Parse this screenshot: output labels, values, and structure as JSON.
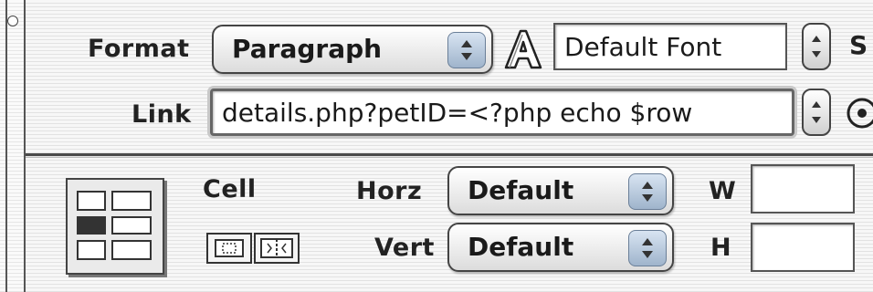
{
  "format": {
    "label": "Format",
    "value": "Paragraph"
  },
  "font": {
    "value": "Default Font",
    "cut_label": "S"
  },
  "link": {
    "label": "Link",
    "value": "details.php?petID=<?php echo $row"
  },
  "cell": {
    "label": "Cell",
    "horz_label": "Horz",
    "horz_value": "Default",
    "vert_label": "Vert",
    "vert_value": "Default",
    "w_label": "W",
    "w_value": "",
    "h_label": "H",
    "h_value": ""
  },
  "icons": {
    "collapse": "collapse-circle-icon",
    "text_style": "outline-a-icon",
    "link_browse": "point-to-file-icon",
    "table_cell": "table-cell-icon",
    "merge": "merge-cells-icon",
    "split": "split-cell-icon"
  }
}
